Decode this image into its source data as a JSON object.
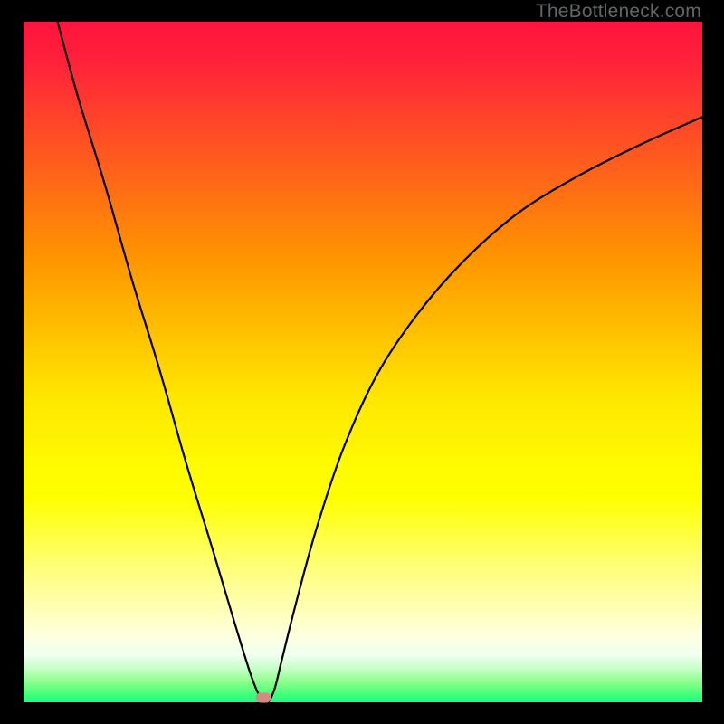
{
  "watermark": "TheBottleneck.com",
  "colors": {
    "frame": "#000000",
    "curve": "#000000",
    "marker": "#d98880",
    "watermark_text": "#626567"
  },
  "chart_data": {
    "type": "line",
    "title": "",
    "xlabel": "",
    "ylabel": "",
    "xlim": [
      0,
      100
    ],
    "ylim": [
      0,
      100
    ],
    "grid": false,
    "legend": false,
    "series": [
      {
        "name": "curve",
        "x": [
          5,
          8,
          12,
          16,
          20,
          24,
          28,
          31,
          33.5,
          35,
          36,
          37,
          38,
          40,
          43,
          47,
          52,
          58,
          65,
          73,
          82,
          91,
          100
        ],
        "y": [
          100,
          89,
          76,
          62,
          49,
          35,
          22,
          12,
          4,
          0.5,
          0,
          2,
          6,
          14,
          25,
          37,
          48,
          57,
          65,
          72,
          77.5,
          82,
          86
        ]
      }
    ],
    "marker": {
      "x": 35.3,
      "y": 0.7
    },
    "background_gradient": {
      "type": "vertical",
      "stops": [
        {
          "pos": 0.0,
          "color": "#ff143c"
        },
        {
          "pos": 0.5,
          "color": "#ffd200"
        },
        {
          "pos": 0.7,
          "color": "#ffff00"
        },
        {
          "pos": 0.9,
          "color": "#ffffdc"
        },
        {
          "pos": 1.0,
          "color": "#14ff8c"
        }
      ]
    }
  }
}
